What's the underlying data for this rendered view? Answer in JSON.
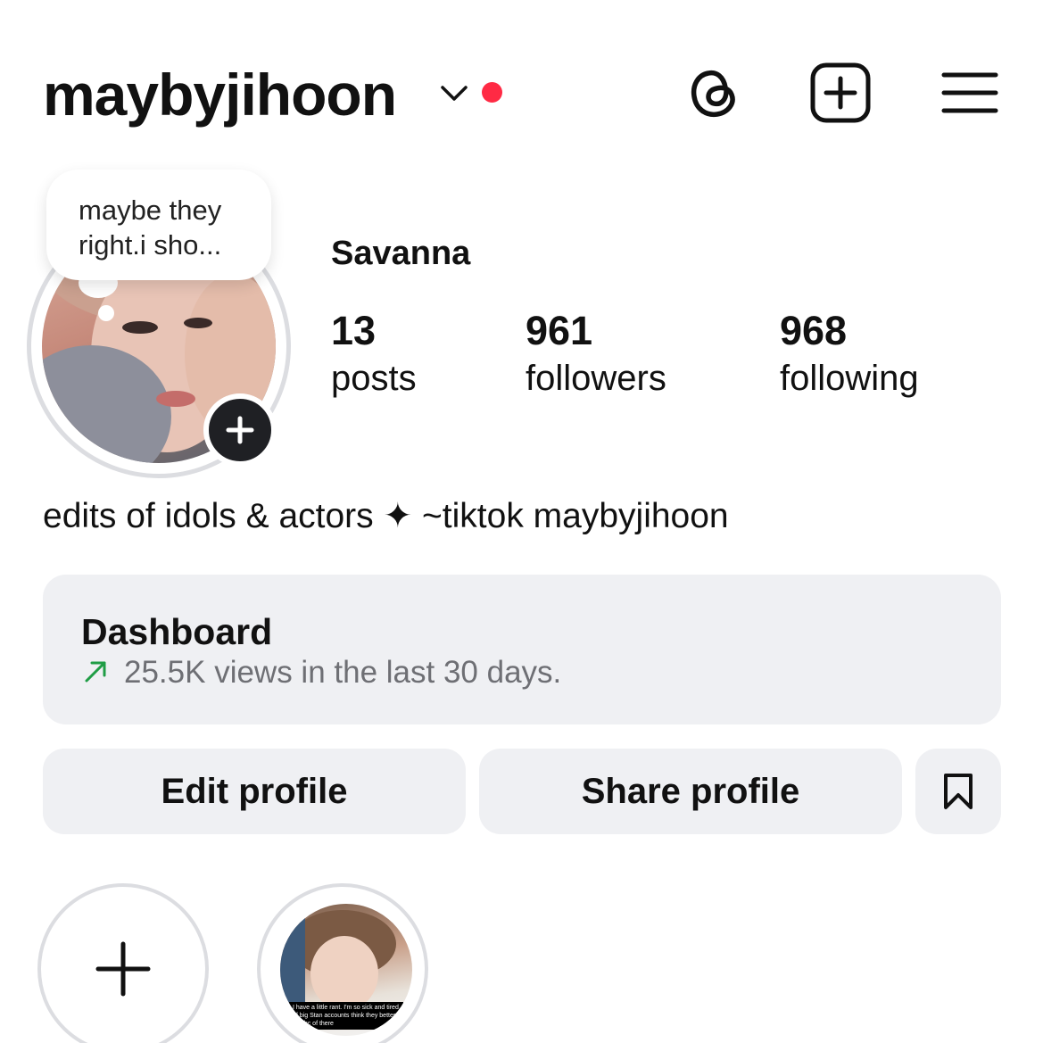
{
  "header": {
    "username": "maybyjihoon",
    "dropdown_icon": "chevron-down-icon",
    "notification_dot_color": "#ff2a44",
    "icons": [
      "threads-icon",
      "new-post-icon",
      "menu-icon"
    ]
  },
  "profile": {
    "note": {
      "line1": "maybe they",
      "line2": "right.i sho..."
    },
    "display_name": "Savanna",
    "stats": [
      {
        "value": "13",
        "label": "posts"
      },
      {
        "value": "961",
        "label": "followers"
      },
      {
        "value": "968",
        "label": "following"
      }
    ],
    "bio": "edits of idols & actors ✦ ~tiktok maybyjihoon"
  },
  "dashboard": {
    "title": "Dashboard",
    "subtitle": "25.5K views in the last 30 days.",
    "trend_color": "#1f9d45"
  },
  "actions": {
    "edit_label": "Edit profile",
    "share_label": "Share profile",
    "save_icon": "bookmark-icon"
  },
  "highlights": {
    "story_caption": "I have a little rant. I'm so sick and tired of big Stan accounts think they better just bc of there"
  },
  "colors": {
    "button_bg": "#eff0f3",
    "ring": "#dcdde1",
    "text": "#111111",
    "muted": "#6e6f74"
  }
}
